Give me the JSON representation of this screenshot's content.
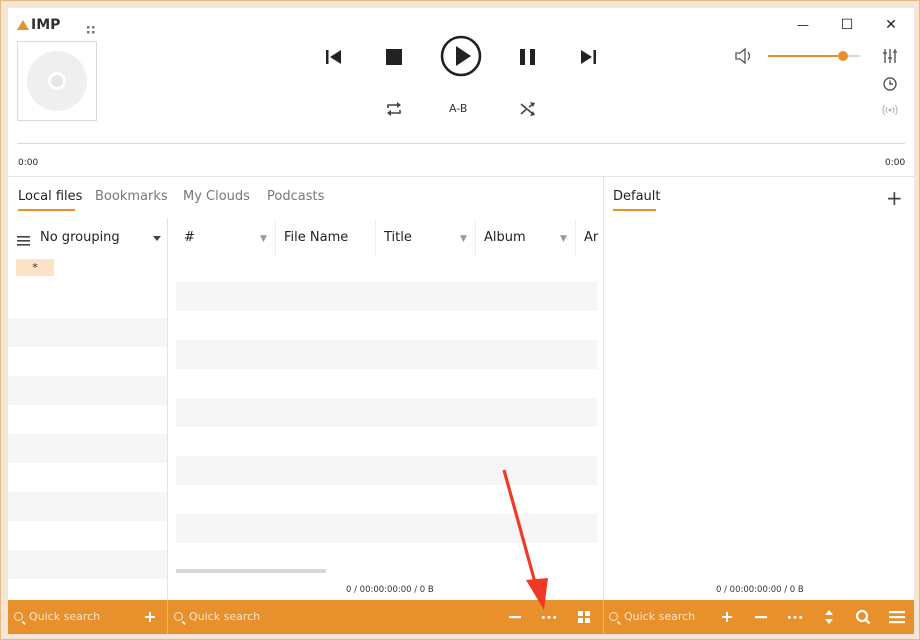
{
  "app": {
    "logo_text": "IMP",
    "accent": "#e8902b"
  },
  "window": {
    "minimize": "—",
    "maximize": "☐",
    "close": "✕"
  },
  "player": {
    "time_elapsed": "0:00",
    "time_total": "0:00",
    "ab_label": "A-B",
    "volume_level": 0.82
  },
  "left_tabs": [
    {
      "label": "Local files",
      "active": true
    },
    {
      "label": "Bookmarks"
    },
    {
      "label": "My Clouds"
    },
    {
      "label": "Podcasts"
    }
  ],
  "grouping": {
    "label": "No grouping",
    "item": "*"
  },
  "columns": [
    "#",
    "File Name",
    "Title",
    "Album",
    "Ar"
  ],
  "status_left": "0 / 00:00:00:00 / 0 B",
  "right_panel": {
    "tab": "Default",
    "add": "+",
    "status": "0 / 00:00:00:00 / 0 B"
  },
  "bottom": {
    "search1_placeholder": "Quick search",
    "search2_placeholder": "Quick search",
    "search3_placeholder": "Quick search"
  }
}
